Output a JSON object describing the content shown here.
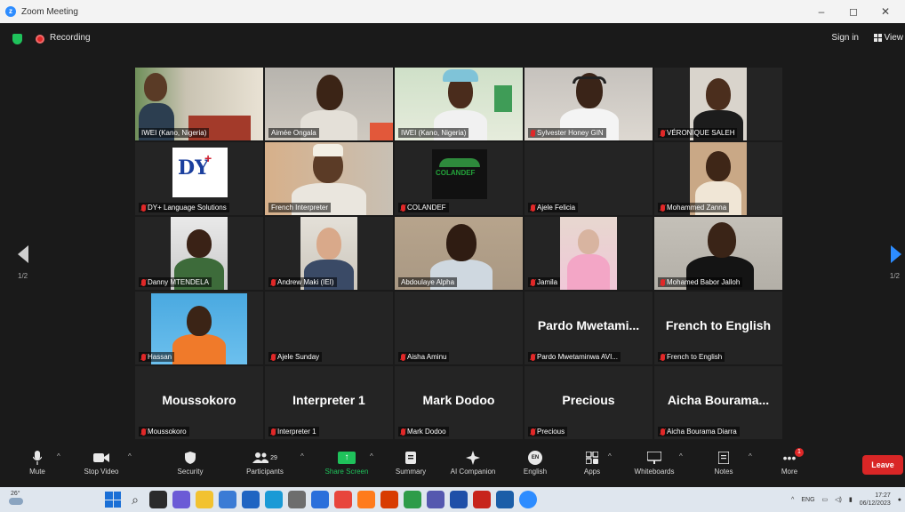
{
  "window": {
    "title": "Zoom Meeting",
    "controls": [
      "–",
      "◻",
      "✕"
    ]
  },
  "topbar": {
    "recording_label": "Recording",
    "signin_label": "Sign in",
    "view_label": "View"
  },
  "gallery": {
    "page_left": "1/2",
    "page_right": "1/2",
    "tiles": [
      {
        "name": "IWEI (Kano, Nigeria)",
        "muted": false,
        "video": true,
        "active": true
      },
      {
        "name": "Aimée Ongala",
        "muted": false,
        "video": true
      },
      {
        "name": "IWEI (Kano, Nigeria)",
        "muted": false,
        "video": true
      },
      {
        "name": "Sylvester Honey GIN",
        "muted": true,
        "video": true
      },
      {
        "name": "VÉRONIQUE SALEH",
        "muted": true,
        "video": true
      },
      {
        "name": "DY+ Language Solutions",
        "muted": true,
        "video": true
      },
      {
        "name": "French Interpreter",
        "muted": false,
        "video": true
      },
      {
        "name": "COLANDEF",
        "muted": true,
        "video": true
      },
      {
        "name": "Ajele Felicia",
        "muted": true,
        "video": false
      },
      {
        "name": "Mohammed Zanna",
        "muted": true,
        "video": true
      },
      {
        "name": "Danny MTENDELA",
        "muted": true,
        "video": true
      },
      {
        "name": "Andrew Maki (IEI)",
        "muted": true,
        "video": true
      },
      {
        "name": "Abdoulaye Alpha",
        "muted": false,
        "video": true
      },
      {
        "name": "Jamila",
        "muted": true,
        "video": true
      },
      {
        "name": "Mohamed Babor Jalloh",
        "muted": true,
        "video": true
      },
      {
        "name": "Hassan",
        "muted": true,
        "video": true
      },
      {
        "name": "Ajele Sunday",
        "muted": true,
        "video": false
      },
      {
        "name": "Aisha Aminu",
        "muted": true,
        "video": false
      },
      {
        "name": "Pardo Mwetaminwa AVI...",
        "display": "Pardo Mwetami...",
        "muted": true,
        "video": false
      },
      {
        "name": "French to English",
        "display": "French to English",
        "muted": true,
        "video": false
      },
      {
        "name": "Moussokoro",
        "display": "Moussokoro",
        "muted": true,
        "video": false
      },
      {
        "name": "Interpreter 1",
        "display": "Interpreter 1",
        "muted": true,
        "video": false
      },
      {
        "name": "Mark Dodoo",
        "display": "Mark Dodoo",
        "muted": true,
        "video": false
      },
      {
        "name": "Precious",
        "display": "Precious",
        "muted": true,
        "video": false
      },
      {
        "name": "Aicha Bourama Diarra",
        "display": "Aicha Bourama...",
        "muted": true,
        "video": false
      }
    ]
  },
  "toolbar": {
    "mute": "Mute",
    "stop_video": "Stop Video",
    "security": "Security",
    "participants": "Participants",
    "participants_count": "29",
    "share_screen": "Share Screen",
    "summary": "Summary",
    "ai_companion": "AI Companion",
    "english": "English",
    "english_badge": "EN",
    "apps": "Apps",
    "whiteboards": "Whiteboards",
    "notes": "Notes",
    "more": "More",
    "more_badge": "1",
    "leave": "Leave"
  },
  "taskbar": {
    "weather_temp": "26°",
    "language": "ENG",
    "time": "17:27",
    "date": "06/12/2023"
  }
}
